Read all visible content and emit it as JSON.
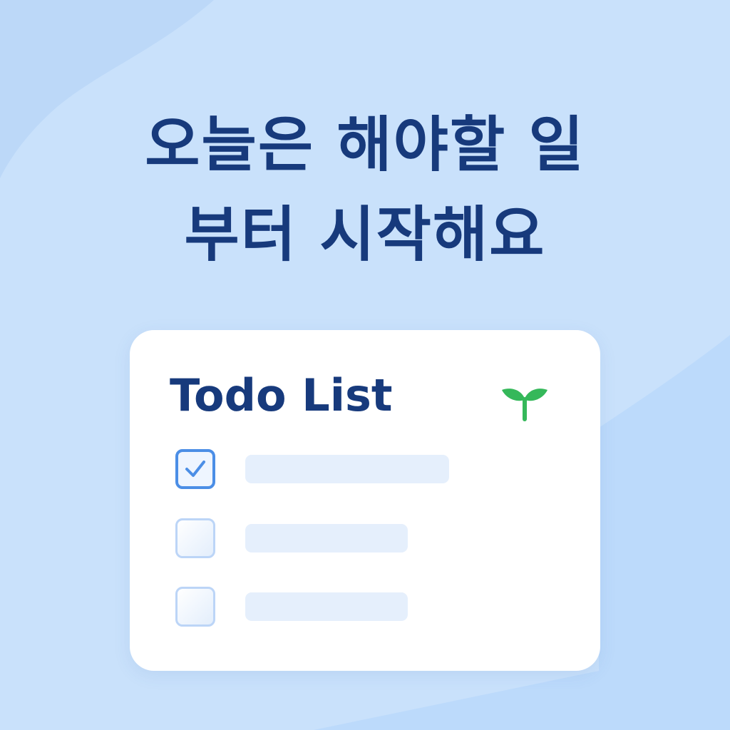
{
  "colors": {
    "background": "#c9e1fb",
    "headline": "#173a7c",
    "card": "#ffffff",
    "checkbox_checked": "#4b8ee6",
    "checkbox_unchecked": "#bcd5f7",
    "item_placeholder": "#e5effc",
    "sprout": "#35b85a"
  },
  "headline": {
    "line1": "오늘은 해야할 일",
    "line2": "부터 시작해요"
  },
  "card": {
    "title": "Todo List",
    "icon": "sprout-icon",
    "items": [
      {
        "checked": true,
        "text": ""
      },
      {
        "checked": false,
        "text": ""
      },
      {
        "checked": false,
        "text": ""
      }
    ]
  }
}
